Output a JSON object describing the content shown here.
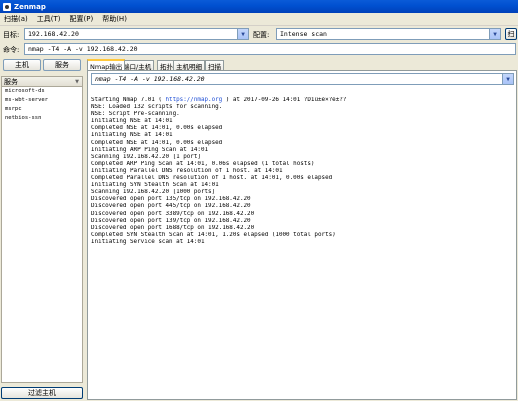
{
  "window": {
    "title": "Zenmap"
  },
  "menu": [
    {
      "label": "扫描(a)"
    },
    {
      "label": "工具(T)"
    },
    {
      "label": "配置(P)"
    },
    {
      "label": "帮助(H)"
    }
  ],
  "target": {
    "label": "目标:",
    "value": "192.168.42.20"
  },
  "profile": {
    "label": "配置:",
    "value": "Intense scan"
  },
  "scan_button": {
    "label": "扫"
  },
  "command": {
    "label": "命令:",
    "value": "nmap -T4 -A -v 192.168.42.20"
  },
  "left_tabs": {
    "hosts": "主机",
    "services": "服务"
  },
  "services": {
    "header": "服务",
    "items": [
      "microsoft-ds",
      "ms-wbt-server",
      "msrpc",
      "netbios-ssn"
    ]
  },
  "filter_button": {
    "label": "过滤主机"
  },
  "tabs": [
    {
      "label": "Nmap输出"
    },
    {
      "label": "端口/主机"
    },
    {
      "label": "拓扑"
    },
    {
      "label": "主机明细"
    },
    {
      "label": "扫描"
    }
  ],
  "host_select": {
    "value": "nmap -T4 -A -v 192.168.42.20"
  },
  "output_lines": [
    {
      "pre": "Starting Nmap 7.01 ( ",
      "link": "https://nmap.org",
      "post": " ) at 2017-09-26 14:01 ?D1ú±ê×?ê±??"
    },
    {
      "pre": "NSE: Loaded 132 scripts for scanning."
    },
    {
      "pre": "NSE: Script Pre-scanning."
    },
    {
      "pre": "Initiating NSE at 14:01"
    },
    {
      "pre": "Completed NSE at 14:01, 0.00s elapsed"
    },
    {
      "pre": "Initiating NSE at 14:01"
    },
    {
      "pre": "Completed NSE at 14:01, 0.00s elapsed"
    },
    {
      "pre": "Initiating ARP Ping Scan at 14:01"
    },
    {
      "pre": "Scanning 192.168.42.20 [1 port]"
    },
    {
      "pre": "Completed ARP Ping Scan at 14:01, 0.06s elapsed (1 total hosts)"
    },
    {
      "pre": "Initiating Parallel DNS resolution of 1 host. at 14:01"
    },
    {
      "pre": "Completed Parallel DNS resolution of 1 host. at 14:01, 0.00s elapsed"
    },
    {
      "pre": "Initiating SYN Stealth Scan at 14:01"
    },
    {
      "pre": "Scanning 192.168.42.20 [1000 ports]"
    },
    {
      "pre": "Discovered open port 135/tcp on 192.168.42.20"
    },
    {
      "pre": "Discovered open port 445/tcp on 192.168.42.20"
    },
    {
      "pre": "Discovered open port 3389/tcp on 192.168.42.20"
    },
    {
      "pre": "Discovered open port 139/tcp on 192.168.42.20"
    },
    {
      "pre": "Discovered open port 1688/tcp on 192.168.42.20"
    },
    {
      "pre": "Completed SYN Stealth Scan at 14:01, 1.20s elapsed (1000 total ports)"
    },
    {
      "pre": "Initiating Service scan at 14:01"
    }
  ]
}
